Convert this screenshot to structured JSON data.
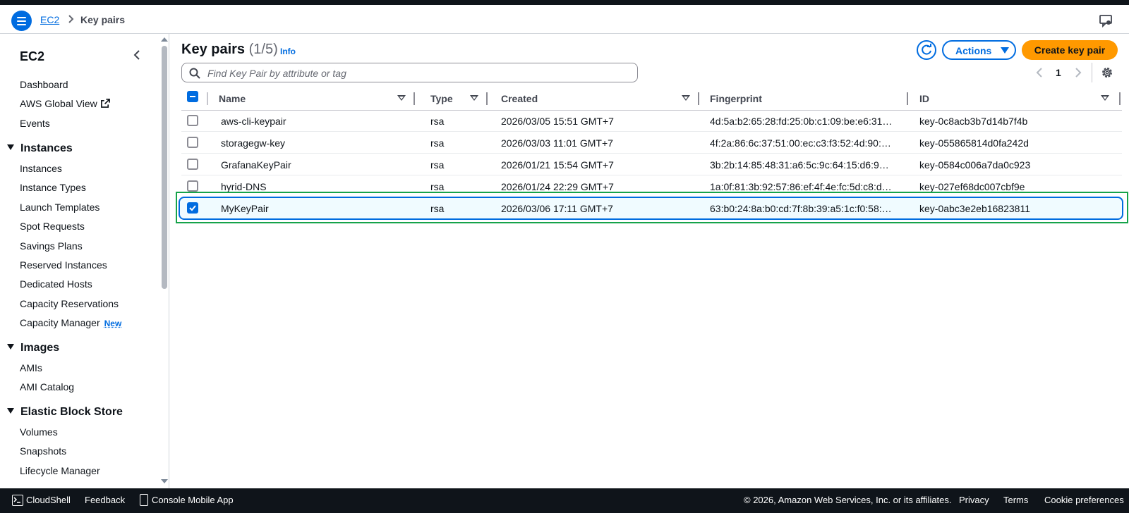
{
  "breadcrumb": {
    "service": "EC2",
    "current": "Key pairs"
  },
  "sidebar": {
    "title": "EC2",
    "top_links": [
      "Dashboard",
      "AWS Global View",
      "Events"
    ],
    "sections": [
      {
        "title": "Instances",
        "items": [
          "Instances",
          "Instance Types",
          "Launch Templates",
          "Spot Requests",
          "Savings Plans",
          "Reserved Instances",
          "Dedicated Hosts",
          "Capacity Reservations",
          "Capacity Manager"
        ]
      },
      {
        "title": "Images",
        "items": [
          "AMIs",
          "AMI Catalog"
        ]
      },
      {
        "title": "Elastic Block Store",
        "items": [
          "Volumes",
          "Snapshots",
          "Lifecycle Manager"
        ]
      }
    ],
    "new_badge": "New"
  },
  "main": {
    "title": "Key pairs",
    "count": "(1/5)",
    "info": "Info",
    "actions_label": "Actions",
    "create_label": "Create key pair",
    "search_placeholder": "Find Key Pair by attribute or tag",
    "page_number": "1"
  },
  "table": {
    "columns": [
      "Name",
      "Type",
      "Created",
      "Fingerprint",
      "ID"
    ],
    "rows": [
      {
        "name": "aws-cli-keypair",
        "type": "rsa",
        "created": "2026/03/05 15:51 GMT+7",
        "fingerprint": "4d:5a:b2:65:28:fd:25:0b:c1:09:be:e6:31…",
        "id": "key-0c8acb3b7d14b7f4b",
        "selected": false
      },
      {
        "name": "storagegw-key",
        "type": "rsa",
        "created": "2026/03/03 11:01 GMT+7",
        "fingerprint": "4f:2a:86:6c:37:51:00:ec:c3:f3:52:4d:90:…",
        "id": "key-055865814d0fa242d",
        "selected": false
      },
      {
        "name": "GrafanaKeyPair",
        "type": "rsa",
        "created": "2026/01/21 15:54 GMT+7",
        "fingerprint": "3b:2b:14:85:48:31:a6:5c:9c:64:15:d6:9…",
        "id": "key-0584c006a7da0c923",
        "selected": false
      },
      {
        "name": "hyrid-DNS",
        "type": "rsa",
        "created": "2026/01/24 22:29 GMT+7",
        "fingerprint": "1a:0f:81:3b:92:57:86:ef:4f:4e:fc:5d:c8:d…",
        "id": "key-027ef68dc007cbf9e",
        "selected": false
      },
      {
        "name": "MyKeyPair",
        "type": "rsa",
        "created": "2026/03/06 17:11 GMT+7",
        "fingerprint": "63:b0:24:8a:b0:cd:7f:8b:39:a5:1c:f0:58:…",
        "id": "key-0abc3e2eb16823811",
        "selected": true
      }
    ]
  },
  "footer": {
    "cloudshell": "CloudShell",
    "feedback": "Feedback",
    "mobile_app": "Console Mobile App",
    "copyright": "© 2026, Amazon Web Services, Inc. or its affiliates.",
    "privacy": "Privacy",
    "terms": "Terms",
    "cookies": "Cookie preferences"
  },
  "colors": {
    "accent": "#006ce0",
    "primary_button": "#ff9900",
    "highlight": "#16a34a",
    "footer_bg": "#0f141a"
  }
}
